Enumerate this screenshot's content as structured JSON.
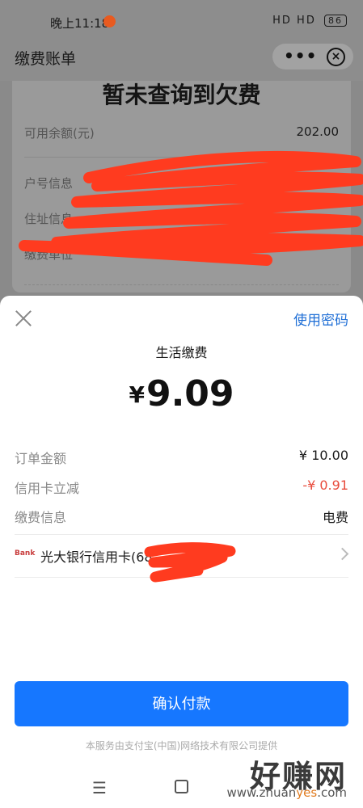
{
  "status_bar": {
    "time": "晚上11:18",
    "indicators": "HD HD",
    "battery": "86"
  },
  "titlebar": {
    "title": "缴费账单",
    "more": "•••",
    "close": "×"
  },
  "bill": {
    "heading": "暂未查询到欠费",
    "balance_label": "可用余额(元)",
    "balance_value": "202.00",
    "account_label": "户号信息",
    "address_label": "住址信息",
    "unit_label": "缴费单位"
  },
  "payment": {
    "use_password": "使用密码",
    "subtitle": "生活缴费",
    "currency": "¥",
    "amount": "9.09",
    "order_label": "订单金额",
    "order_value": "¥ 10.00",
    "discount_label": "信用卡立减",
    "discount_value": "-¥ 0.91",
    "info_label": "缴费信息",
    "info_value": "电费",
    "bank_logo": "Bank",
    "bank_label": "光大银行信用卡(68",
    "confirm": "确认付款",
    "footnote": "本服务由支付宝(中国)网络技术有限公司提供"
  },
  "watermark": {
    "text": "好赚网",
    "url_prefix": "www.zhuan",
    "url_highlight": "yes",
    "url_suffix": ".com"
  },
  "colors": {
    "accent": "#1677ff",
    "discount": "#e84b3c",
    "scribble": "#ff3b1f"
  }
}
